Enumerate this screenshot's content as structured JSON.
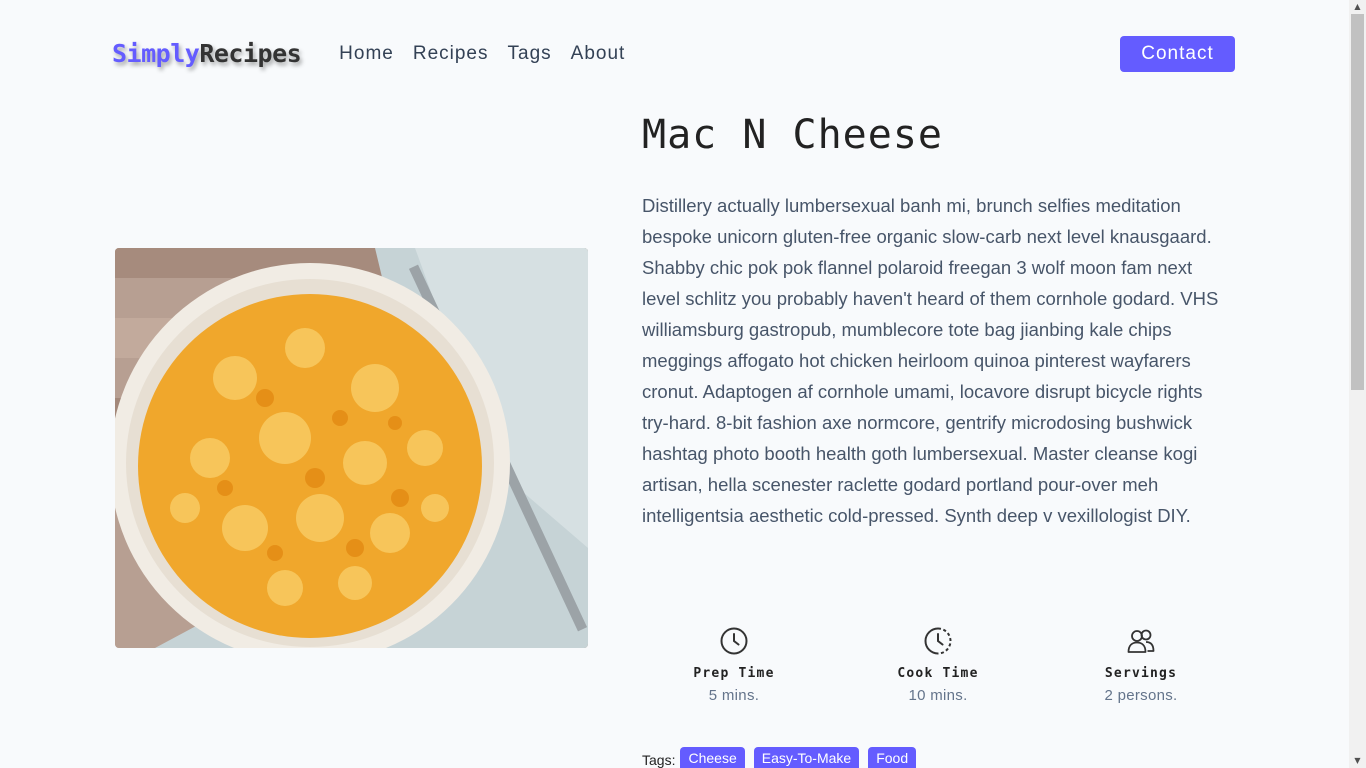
{
  "brand": {
    "part1": "Simply",
    "part2": "Recipes"
  },
  "nav": {
    "links": [
      "Home",
      "Recipes",
      "Tags",
      "About"
    ],
    "contact_label": "Contact"
  },
  "recipe": {
    "title": "Mac N Cheese",
    "description": "Distillery actually lumbersexual banh mi, brunch selfies meditation bespoke unicorn gluten-free organic slow-carb next level knausgaard. Shabby chic pok pok flannel polaroid freegan 3 wolf moon fam next level schlitz you probably haven't heard of them cornhole godard. VHS williamsburg gastropub, mumblecore tote bag jianbing kale chips meggings affogato hot chicken heirloom quinoa pinterest wayfarers cronut. Adaptogen af cornhole umami, locavore disrupt bicycle rights try-hard. 8-bit fashion axe normcore, gentrify microdosing bushwick hashtag photo booth health goth lumbersexual. Master cleanse kogi artisan, hella scenester raclette godard portland pour-over meh intelligentsia aesthetic cold-pressed. Synth deep v vexillologist DIY.",
    "stats": [
      {
        "label": "Prep Time",
        "value": "5 mins.",
        "icon": "clock-icon"
      },
      {
        "label": "Cook Time",
        "value": "10 mins.",
        "icon": "clock-dashed-icon"
      },
      {
        "label": "Servings",
        "value": "2 persons.",
        "icon": "users-icon"
      }
    ],
    "tags_label": "Tags:",
    "tags": [
      "Cheese",
      "Easy-To-Make",
      "Food"
    ]
  },
  "colors": {
    "accent": "#645cff",
    "background": "#f8fafc",
    "text": "#475569"
  }
}
